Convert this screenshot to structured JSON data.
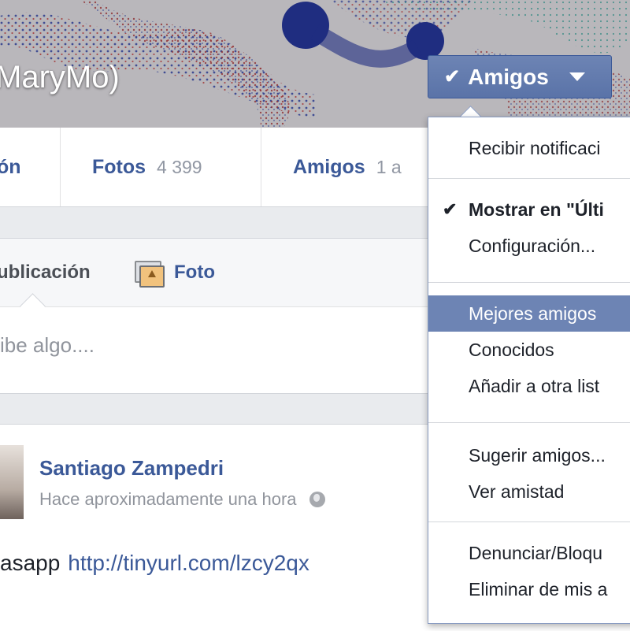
{
  "profile": {
    "name_fragment": "MaryMo)"
  },
  "friend_button": {
    "label": "Amigos",
    "checked": true
  },
  "tabs": [
    {
      "label": "ón",
      "count": ""
    },
    {
      "label": "Fotos",
      "count": "4 399"
    },
    {
      "label": "Amigos",
      "count": "1 a"
    }
  ],
  "composer": {
    "status_label": "ublicación",
    "photo_label": "Foto",
    "placeholder": "ibe algo...."
  },
  "post": {
    "author": "Santiago Zampedri",
    "timestamp": "Hace aproximadamente una hora",
    "text": "asapp",
    "link": "http://tinyurl.com/lzcy2qx"
  },
  "dropdown": {
    "items": [
      {
        "label": "Recibir notificaci"
      },
      {
        "label": "Mostrar en \"Últi",
        "checked": true
      },
      {
        "label": "Configuración..."
      },
      {
        "label": "Mejores amigos",
        "active": true
      },
      {
        "label": "Conocidos"
      },
      {
        "label": "Añadir a otra list"
      },
      {
        "label": "Sugerir amigos..."
      },
      {
        "label": "Ver amistad"
      },
      {
        "label": "Denunciar/Bloqu"
      },
      {
        "label": "Eliminar de mis a"
      }
    ]
  }
}
